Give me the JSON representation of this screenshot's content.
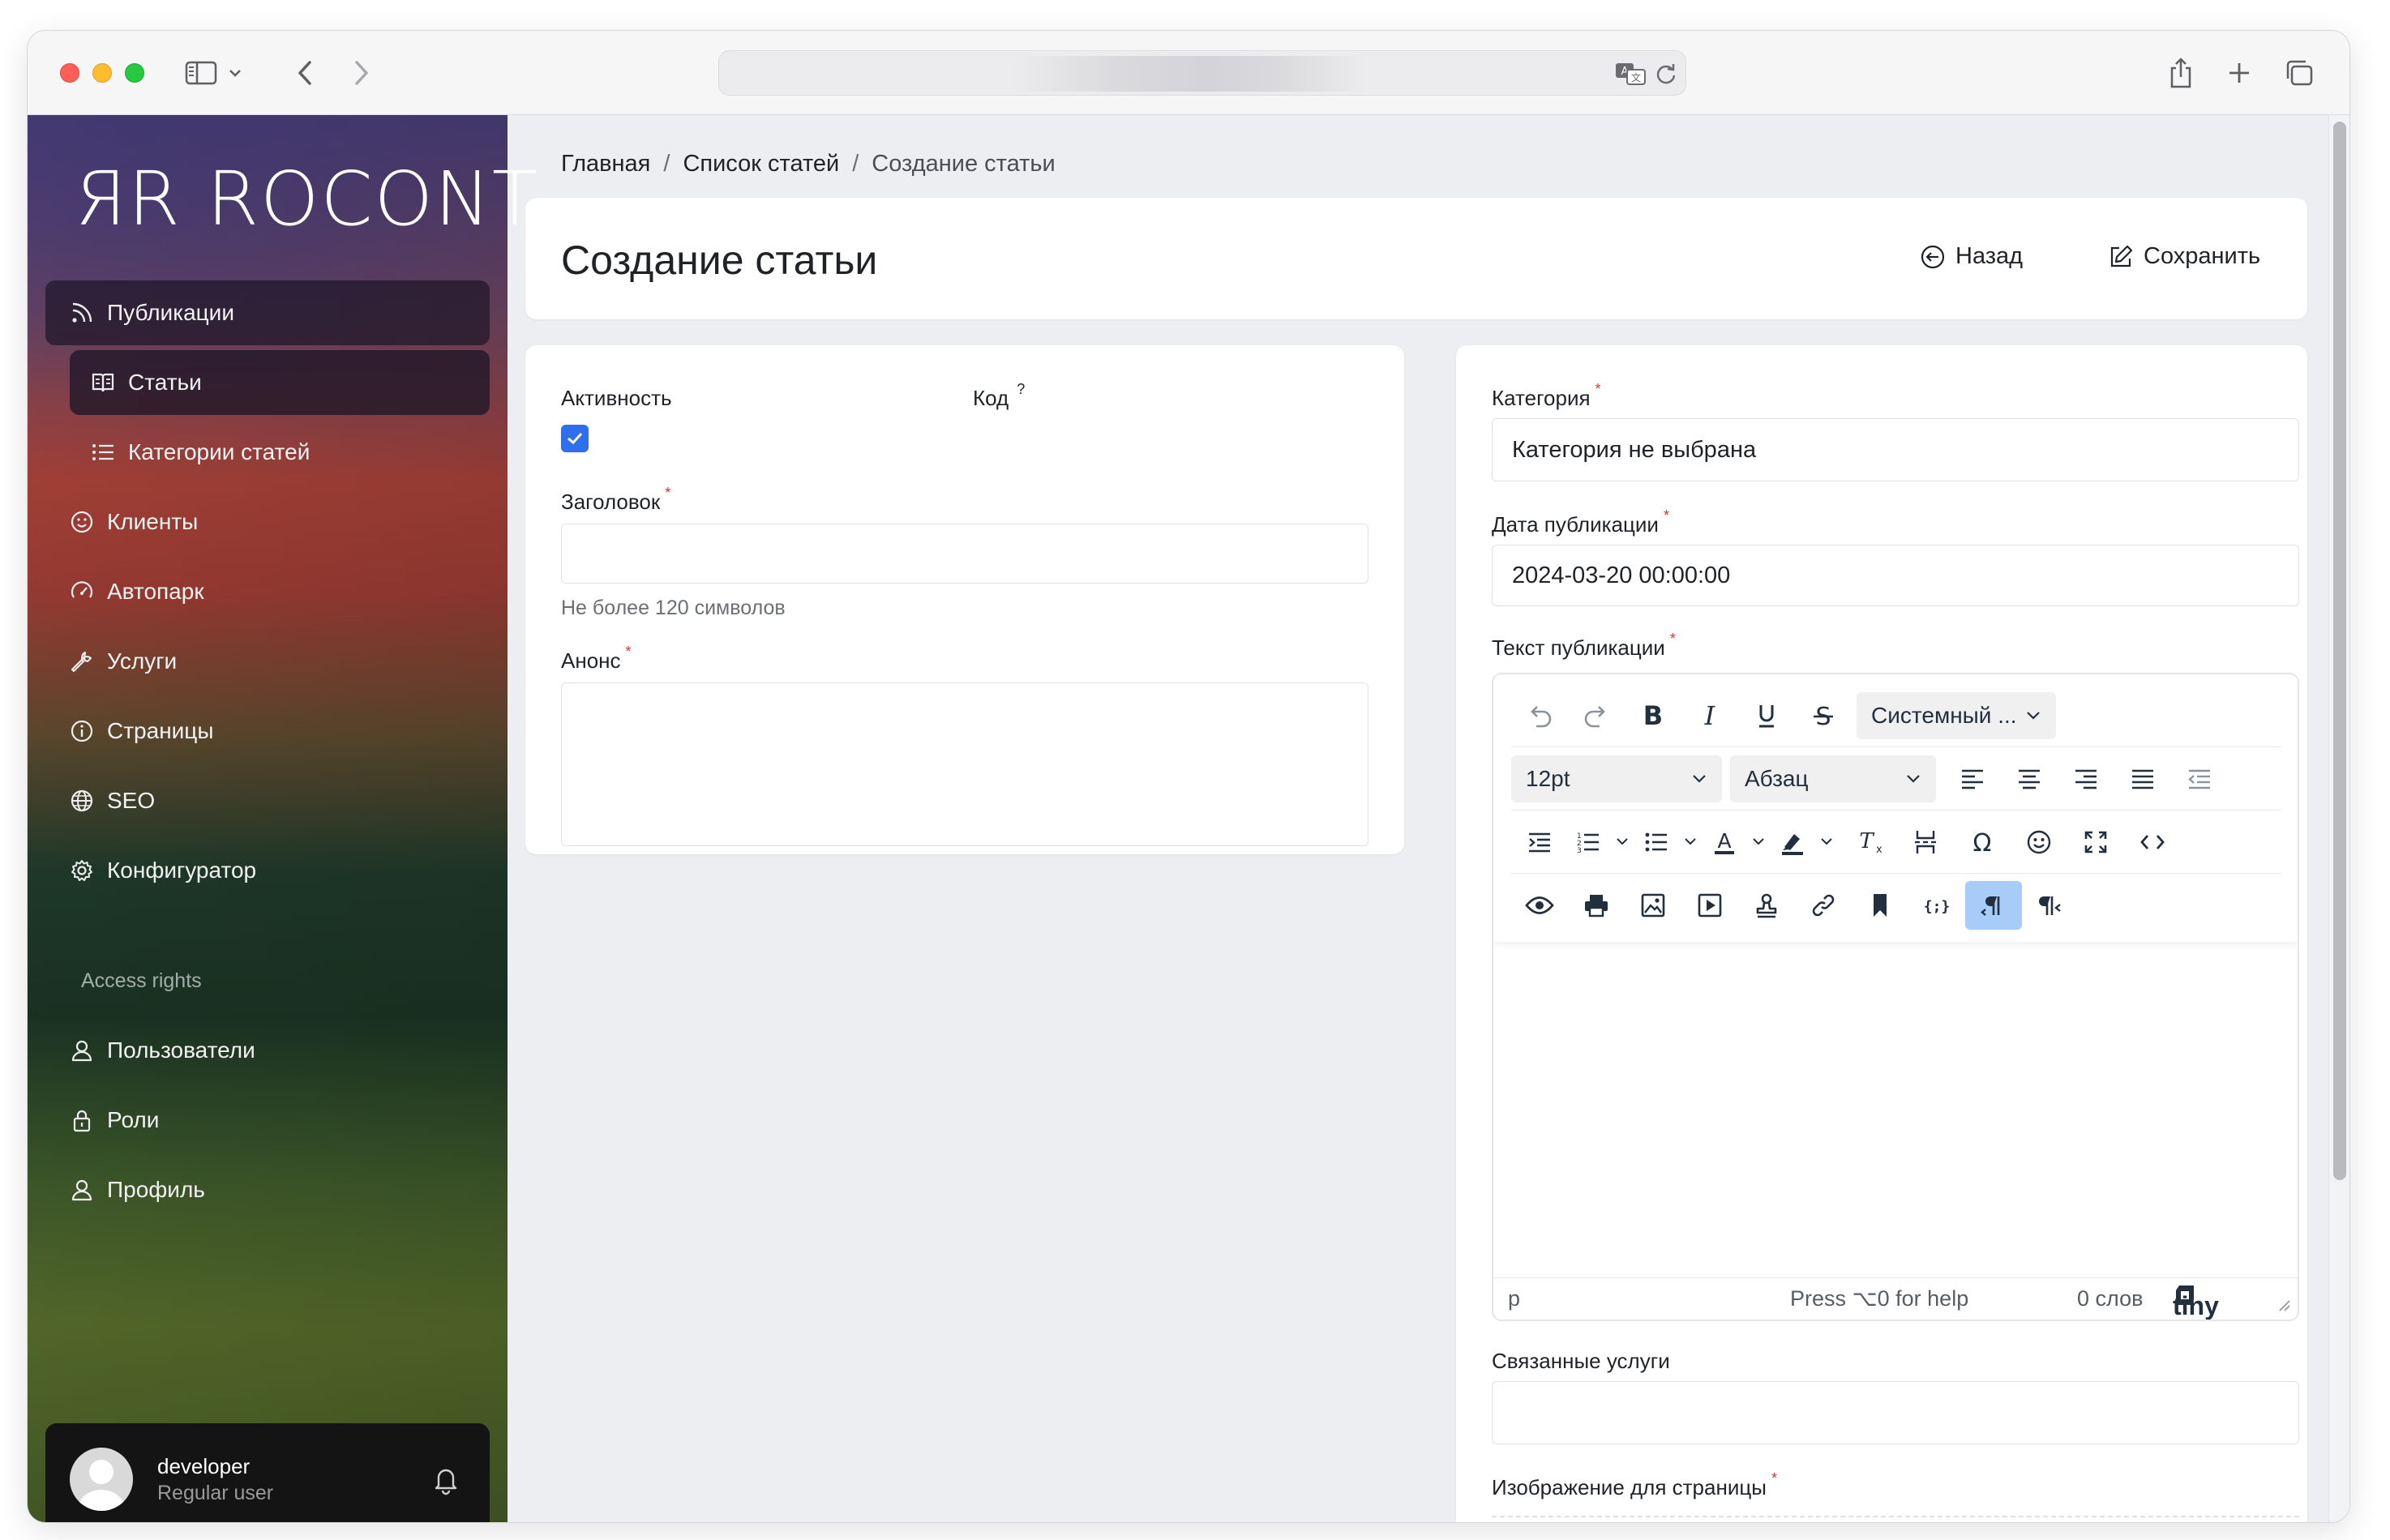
{
  "browser": {
    "url": ""
  },
  "sidebar": {
    "logo": "ЯR ROCONT",
    "items": [
      {
        "label": "Публикации",
        "icon": "rss-icon"
      },
      {
        "label": "Статьи",
        "icon": "book-icon"
      },
      {
        "label": "Категории статей",
        "icon": "list-icon"
      },
      {
        "label": "Клиенты",
        "icon": "smile-icon"
      },
      {
        "label": "Автопарк",
        "icon": "gauge-icon"
      },
      {
        "label": "Услуги",
        "icon": "wrench-icon"
      },
      {
        "label": "Страницы",
        "icon": "info-icon"
      },
      {
        "label": "SEO",
        "icon": "globe-icon"
      },
      {
        "label": "Конфигуратор",
        "icon": "gear-icon"
      }
    ],
    "section_label": "Access rights",
    "access_items": [
      {
        "label": "Пользователи",
        "icon": "user-icon"
      },
      {
        "label": "Роли",
        "icon": "lock-icon"
      },
      {
        "label": "Профиль",
        "icon": "user-icon"
      }
    ],
    "user": {
      "name": "developer",
      "role": "Regular user"
    }
  },
  "breadcrumb": {
    "home": "Главная",
    "list": "Список статей",
    "current": "Создание статьи"
  },
  "header": {
    "title": "Создание статьи",
    "back_label": "Назад",
    "save_label": "Сохранить"
  },
  "form_left": {
    "activity_label": "Активность",
    "activity_checked": true,
    "code_label": "Код",
    "code_hint_mark": "?",
    "title_label": "Заголовок",
    "title_value": "",
    "title_hint": "Не более 120 символов",
    "announce_label": "Анонс",
    "announce_value": "",
    "required_mark": "*"
  },
  "form_right": {
    "category_label": "Категория",
    "category_value": "Категория не выбрана",
    "date_label": "Дата публикации",
    "date_value": "2024-03-20 00:00:00",
    "text_label": "Текст публикации",
    "related_label": "Связанные услуги",
    "related_value": "",
    "image_label": "Изображение для страницы",
    "required_mark": "*"
  },
  "editor": {
    "font_family": "Системный ...",
    "font_size": "12pt",
    "block_format": "Абзац",
    "status_path": "p",
    "status_help": "Press ⌥0 for help",
    "word_count": "0 слов",
    "brand": "tiny"
  }
}
